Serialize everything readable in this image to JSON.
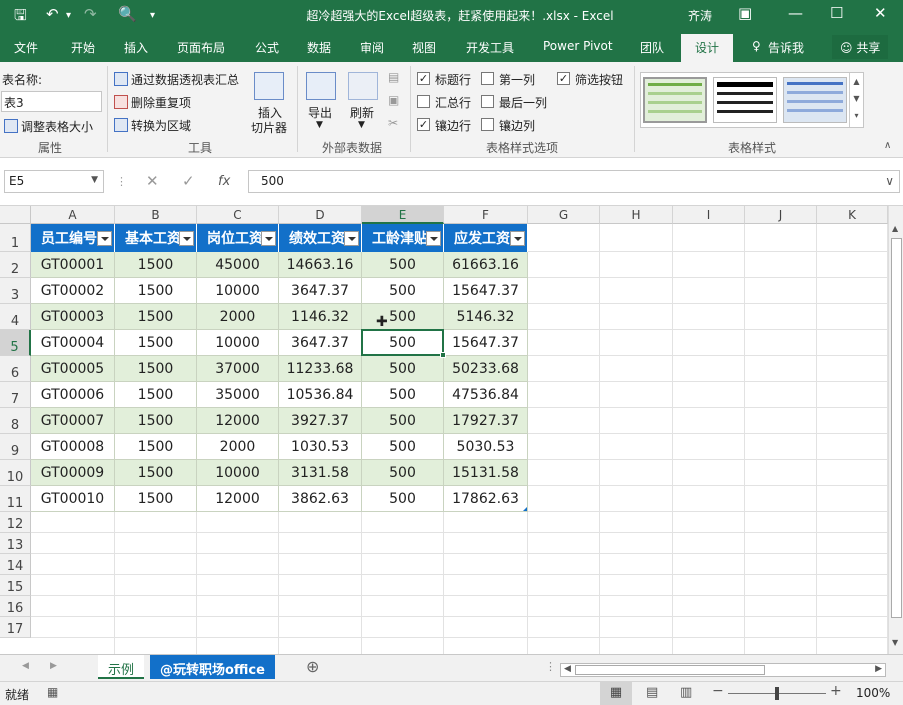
{
  "window": {
    "title": "超冷超强大的Excel超级表，赶紧使用起来！.xlsx  -  Excel",
    "user": "齐涛"
  },
  "tabs": [
    "文件",
    "开始",
    "插入",
    "页面布局",
    "公式",
    "数据",
    "审阅",
    "视图",
    "开发工具",
    "Power Pivot",
    "团队",
    "设计"
  ],
  "active_tab": "设计",
  "tell_me": "告诉我",
  "share": "共享",
  "ribbon": {
    "properties": {
      "label_table_name": "表名称:",
      "table_name": "表3",
      "resize": "调整表格大小",
      "group": "属性"
    },
    "tools": {
      "pivot": "通过数据透视表汇总",
      "remove_dupes": "删除重复项",
      "convert": "转换为区域",
      "slicer_line1": "插入",
      "slicer_line2": "切片器",
      "group": "工具"
    },
    "external": {
      "export": "导出",
      "refresh": "刷新",
      "group": "外部表数据"
    },
    "options": {
      "header_row": "标题行",
      "total_row": "汇总行",
      "banded_rows": "镶边行",
      "first_col": "第一列",
      "last_col": "最后一列",
      "banded_cols": "镶边列",
      "filter_btn": "筛选按钮",
      "group": "表格样式选项",
      "checked": {
        "header_row": true,
        "total_row": false,
        "banded_rows": true,
        "first_col": false,
        "last_col": false,
        "banded_cols": false,
        "filter_btn": true
      }
    },
    "styles": {
      "group": "表格样式"
    }
  },
  "formula_bar": {
    "name_box": "E5",
    "fx": "fx",
    "value": "500"
  },
  "grid": {
    "columns": [
      "A",
      "B",
      "C",
      "D",
      "E",
      "F",
      "G",
      "H",
      "I",
      "J",
      "K"
    ],
    "rows": [
      "1",
      "2",
      "3",
      "4",
      "5",
      "6",
      "7",
      "8",
      "9",
      "10",
      "11",
      "12",
      "13",
      "14",
      "15",
      "16",
      "17"
    ],
    "active_column": "E",
    "active_row": "5"
  },
  "table": {
    "headers": [
      "员工编号",
      "基本工资",
      "岗位工资",
      "绩效工资",
      "工龄津贴",
      "应发工资"
    ],
    "rows": [
      [
        "GT00001",
        "1500",
        "45000",
        "14663.16",
        "500",
        "61663.16"
      ],
      [
        "GT00002",
        "1500",
        "10000",
        "3647.37",
        "500",
        "15647.37"
      ],
      [
        "GT00003",
        "1500",
        "2000",
        "1146.32",
        "500",
        "5146.32"
      ],
      [
        "GT00004",
        "1500",
        "10000",
        "3647.37",
        "500",
        "15647.37"
      ],
      [
        "GT00005",
        "1500",
        "37000",
        "11233.68",
        "500",
        "50233.68"
      ],
      [
        "GT00006",
        "1500",
        "35000",
        "10536.84",
        "500",
        "47536.84"
      ],
      [
        "GT00007",
        "1500",
        "12000",
        "3927.37",
        "500",
        "17927.37"
      ],
      [
        "GT00008",
        "1500",
        "2000",
        "1030.53",
        "500",
        "5030.53"
      ],
      [
        "GT00009",
        "1500",
        "10000",
        "3131.58",
        "500",
        "15131.58"
      ],
      [
        "GT00010",
        "1500",
        "12000",
        "3862.63",
        "500",
        "17862.63"
      ]
    ]
  },
  "sheets": [
    "示例",
    "@玩转职场office"
  ],
  "active_sheet": "示例",
  "status": {
    "ready": "就绪",
    "zoom": "100%"
  },
  "colors": {
    "excel_green": "#217346",
    "table_header_blue": "#1270c9",
    "band_green": "#e2efda"
  }
}
